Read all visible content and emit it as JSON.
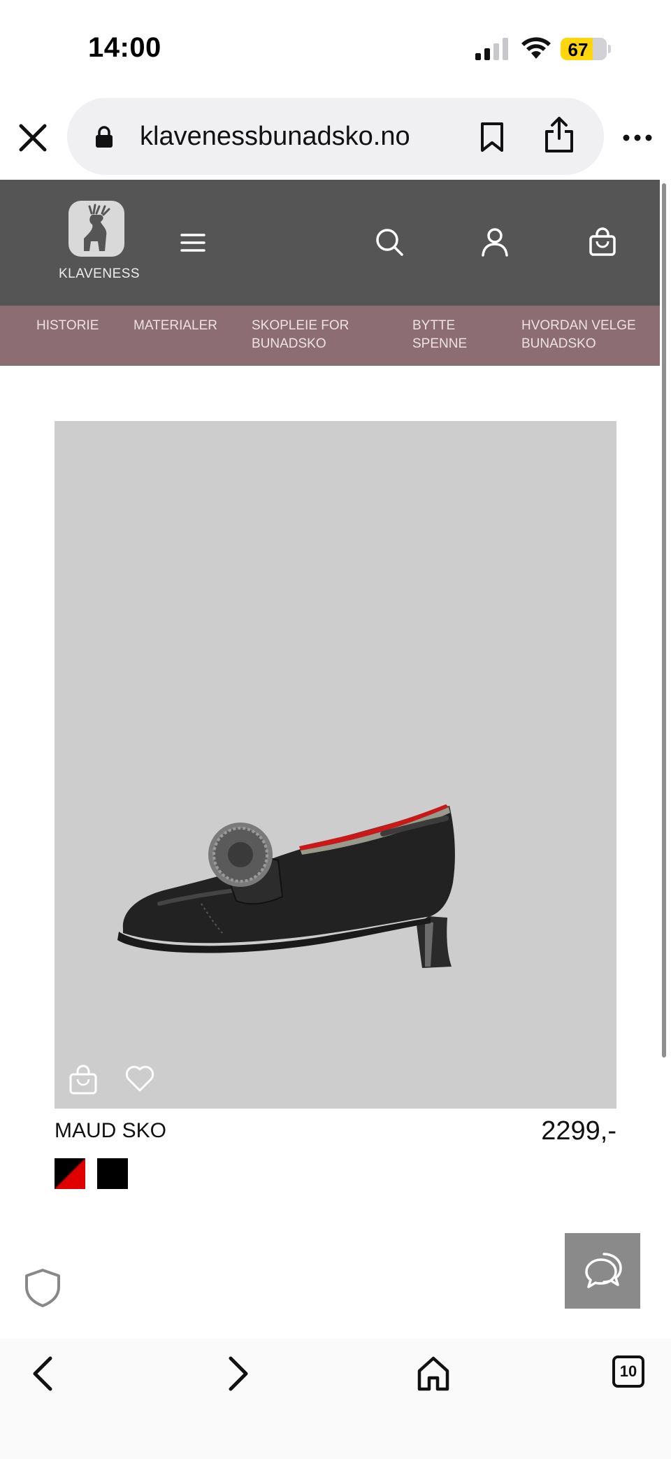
{
  "status": {
    "time": "14:00",
    "battery": "67"
  },
  "browser": {
    "url": "klavenessbunadsko.no",
    "tab_count": "10"
  },
  "header": {
    "logo_text": "KLAVENESS"
  },
  "categories": [
    {
      "line1": "HISTORIE",
      "line2": ""
    },
    {
      "line1": "MATERIALER",
      "line2": ""
    },
    {
      "line1": "SKOPLEIE FOR",
      "line2": "BUNADSKO"
    },
    {
      "line1": "BYTTE",
      "line2": "SPENNE"
    },
    {
      "line1": "HVORDAN VELGE",
      "line2": "BUNADSKO"
    }
  ],
  "product": {
    "name": "MAUD SKO",
    "price": "2299,-",
    "swatches": [
      "black-red",
      "black"
    ]
  },
  "colors": {
    "header_bg": "#555555",
    "nav_bg": "#8c6d73",
    "image_bg": "#cdcdcd",
    "chat_bg": "#8a8a8a",
    "battery": "#ffd60a"
  }
}
